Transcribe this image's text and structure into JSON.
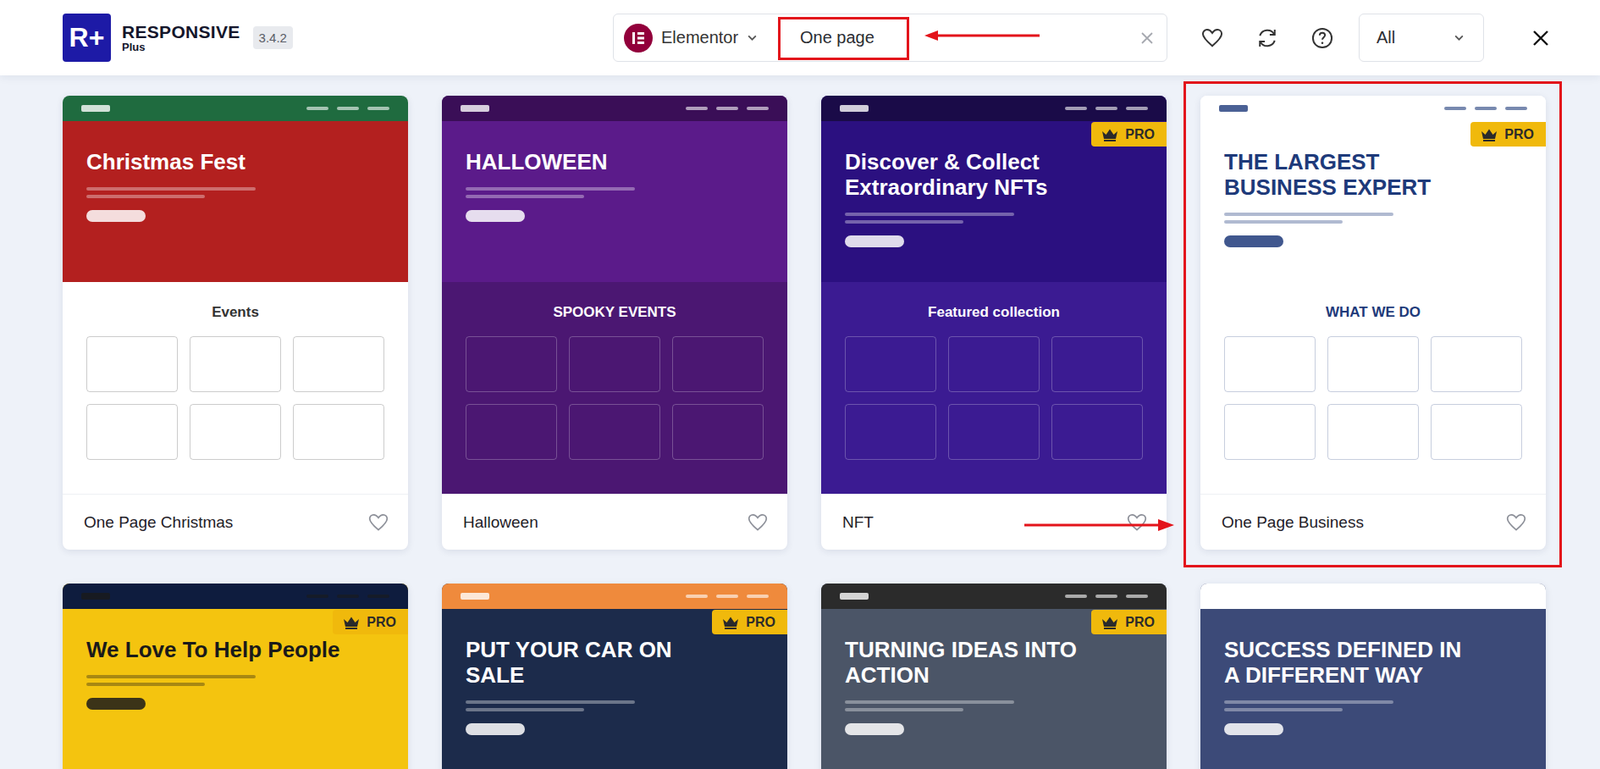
{
  "app": {
    "logo_mark": "R+",
    "name": "RESPONSIVE",
    "edition": "Plus",
    "version": "3.4.2"
  },
  "builder": {
    "label": "Elementor"
  },
  "search": {
    "value": "One page",
    "highlighted": true
  },
  "filter": {
    "value": "All"
  },
  "pro_label": "PRO",
  "cards": [
    {
      "title": "One Page Christmas",
      "pro": false,
      "favorite": false,
      "highlighted": false,
      "preview": {
        "nav": "#1f6b3f",
        "hero": "#b3201f",
        "body": "#ffffff",
        "ink": "#ffffff",
        "body_ink": "#333333",
        "headline": "Christmas Fest",
        "section": "Events"
      }
    },
    {
      "title": "Halloween",
      "pro": false,
      "favorite": false,
      "highlighted": false,
      "preview": {
        "nav": "#3a0e57",
        "hero": "#5b1b8a",
        "body": "#4b1772",
        "ink": "#ffffff",
        "body_ink": "#ffffff",
        "headline": "HALLOWEEN",
        "section": "SPOOKY EVENTS"
      }
    },
    {
      "title": "NFT",
      "pro": true,
      "favorite": false,
      "highlighted": false,
      "preview": {
        "nav": "#1a0b48",
        "hero": "#2b1080",
        "body": "#3b1b92",
        "ink": "#ffffff",
        "body_ink": "#ffffff",
        "headline": "Discover & Collect Extraordinary NFTs",
        "section": "Featured collection"
      }
    },
    {
      "title": "One Page Business",
      "pro": true,
      "favorite": false,
      "highlighted": true,
      "preview": {
        "nav": "#ffffff",
        "hero": "#ffffff",
        "body": "#ffffff",
        "ink": "#1e3a7a",
        "body_ink": "#1e3a7a",
        "headline": "THE LARGEST BUSINESS EXPERT",
        "section": "WHAT WE DO"
      }
    },
    {
      "pro": true,
      "highlighted": false,
      "preview": {
        "nav": "#0e1c3e",
        "hero": "#f4c40f",
        "body": "#f4c40f",
        "ink": "#1a1a1a",
        "body_ink": "#1a1a1a",
        "headline": "We Love To Help People"
      }
    },
    {
      "pro": true,
      "highlighted": false,
      "preview": {
        "nav": "#ef8a3c",
        "hero": "#1c2b4b",
        "body": "#1c2b4b",
        "ink": "#ffffff",
        "body_ink": "#ffffff",
        "headline": "PUT YOUR CAR ON SALE"
      }
    },
    {
      "pro": true,
      "highlighted": false,
      "preview": {
        "nav": "#2b2b2b",
        "hero": "#4b5567",
        "body": "#4b5567",
        "ink": "#ffffff",
        "body_ink": "#ffffff",
        "headline": "TURNING IDEAS INTO ACTION"
      }
    },
    {
      "pro": false,
      "highlighted": false,
      "preview": {
        "nav": "#ffffff",
        "hero": "#3c4a78",
        "body": "#3c4a78",
        "ink": "#ffffff",
        "body_ink": "#ffffff",
        "headline": "SUCCESS DEFINED IN A DIFFERENT WAY"
      }
    }
  ]
}
